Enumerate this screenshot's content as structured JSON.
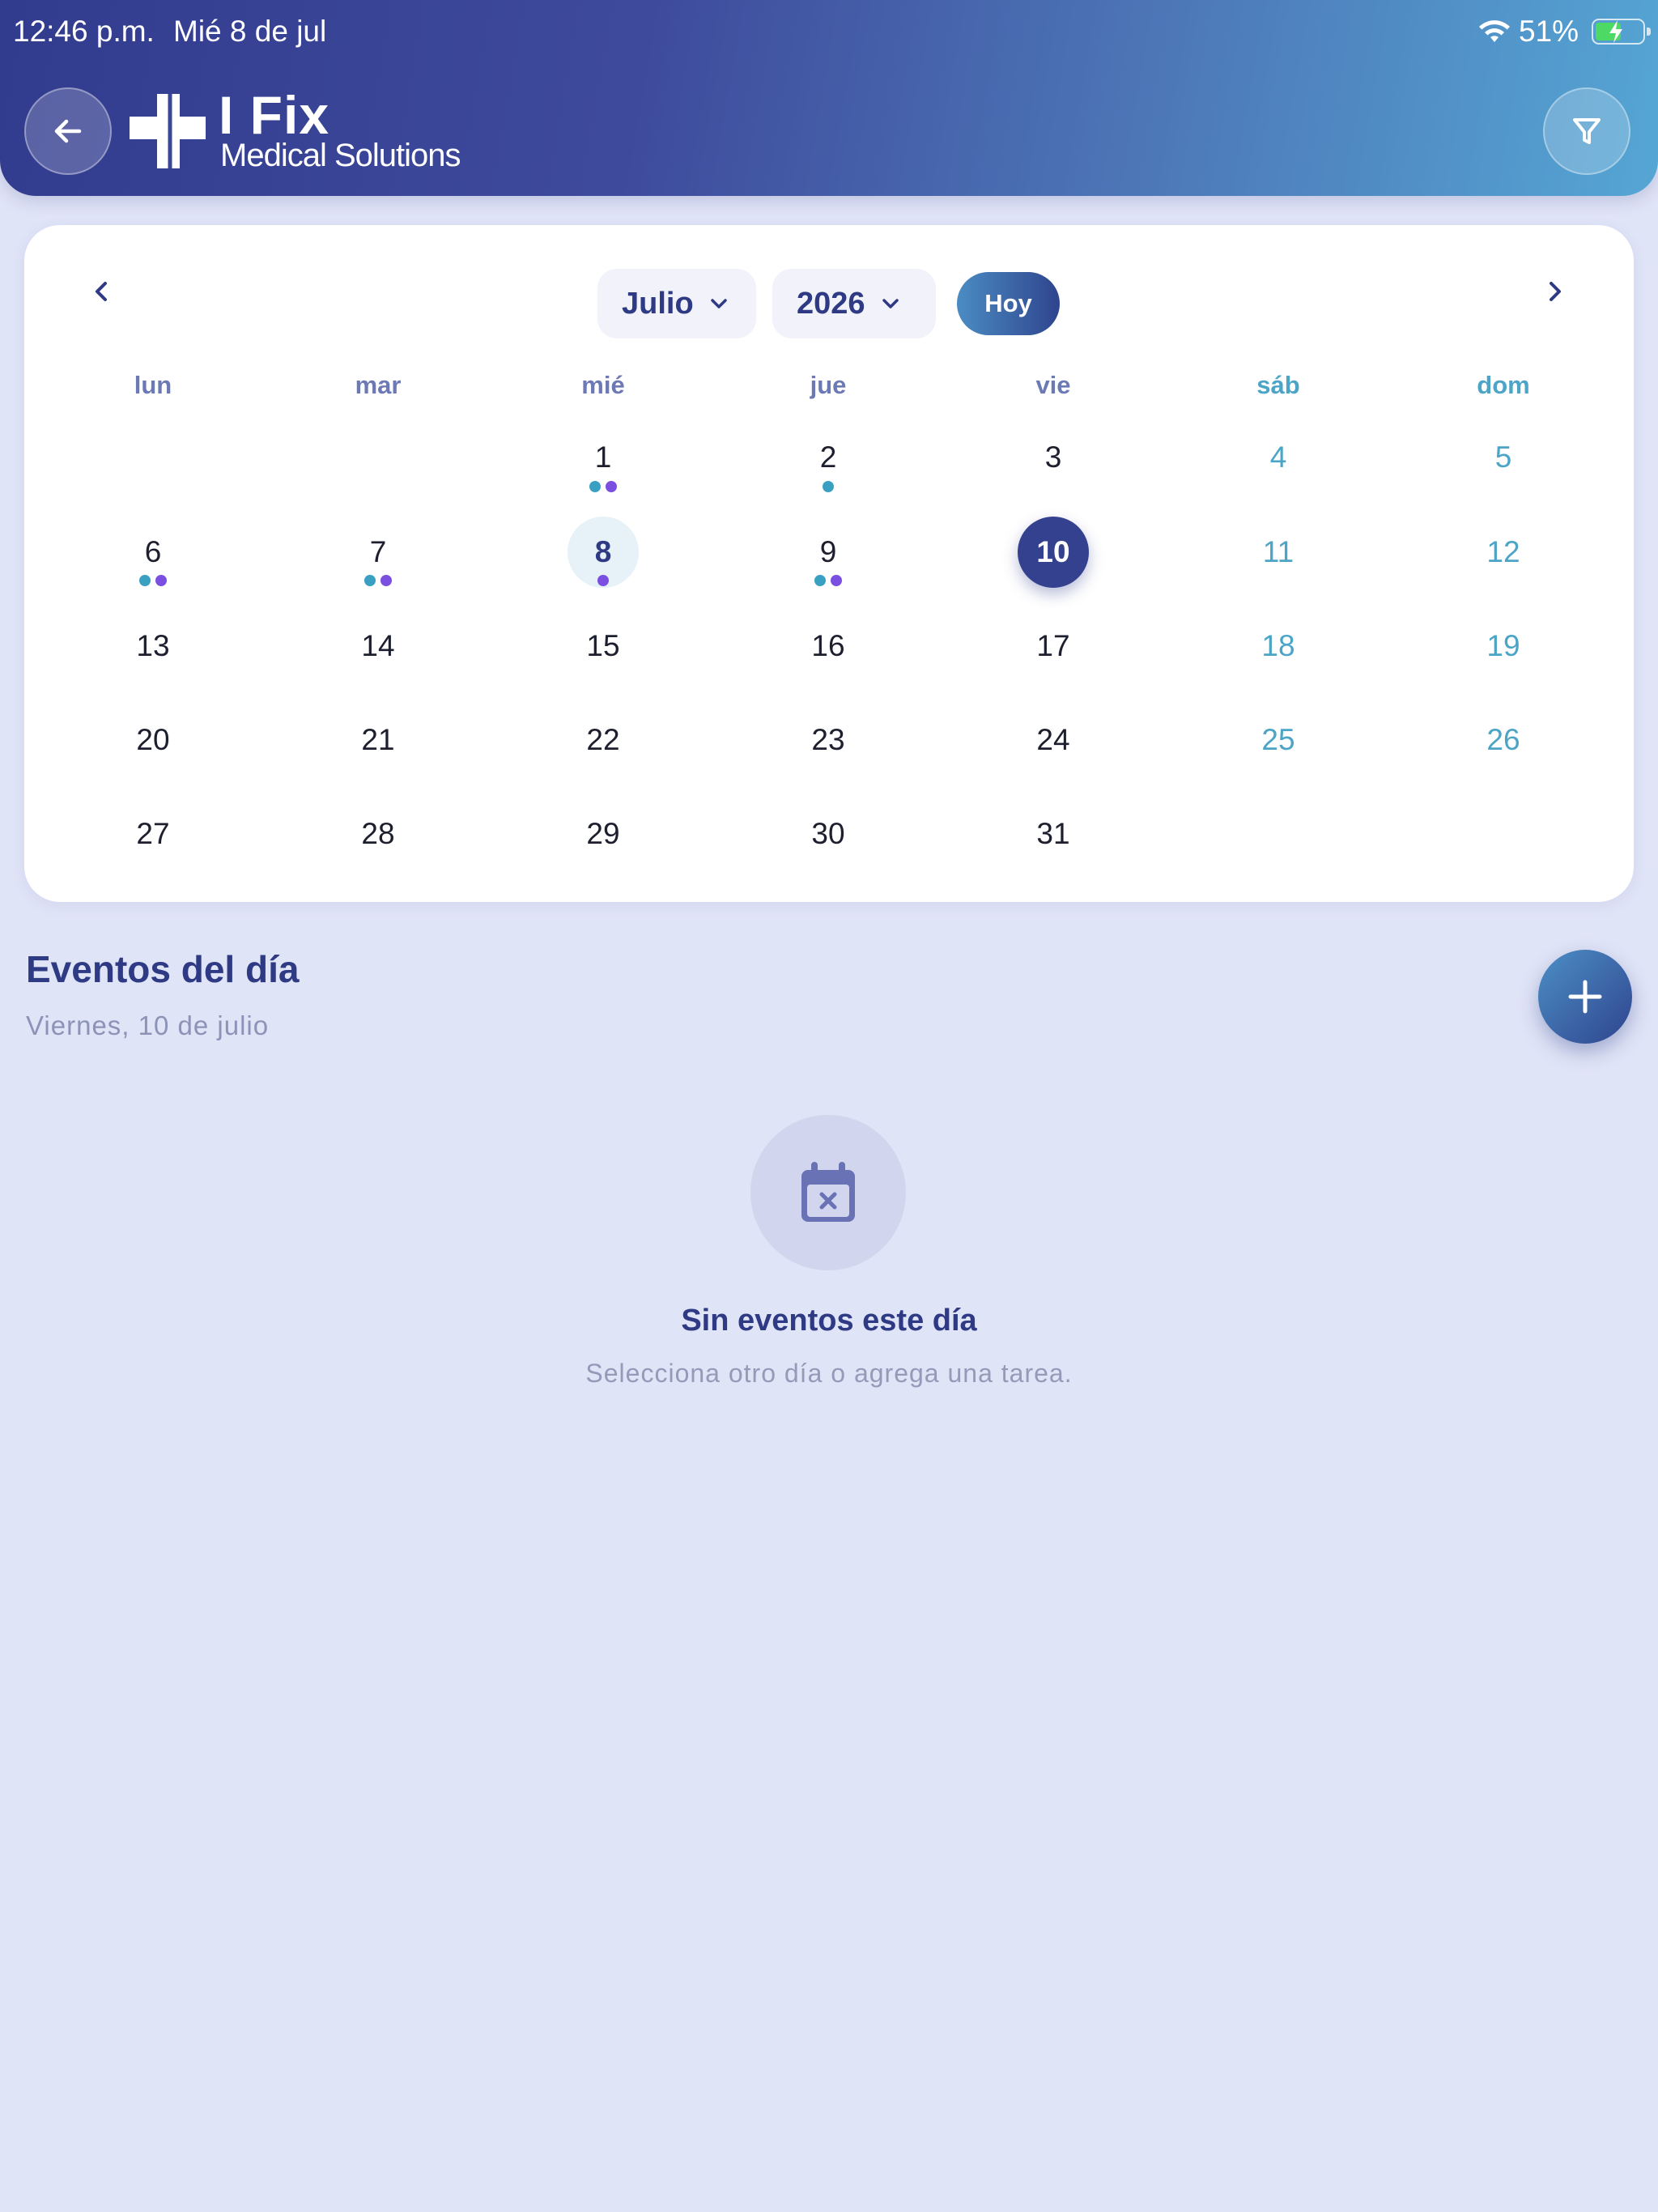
{
  "status_bar": {
    "time": "12:46 p.m.",
    "date": "Mié 8 de jul",
    "battery": "51%"
  },
  "header": {
    "brand": "I Fix",
    "subtitle": "Medical Solutions"
  },
  "calendar": {
    "month": "Julio",
    "year": "2026",
    "today_button": "Hoy",
    "weekdays": [
      "lun",
      "mar",
      "mié",
      "jue",
      "vie",
      "sáb",
      "dom"
    ],
    "days": [
      "1",
      "2",
      "3",
      "4",
      "5",
      "6",
      "7",
      "8",
      "9",
      "10",
      "11",
      "12",
      "13",
      "14",
      "15",
      "16",
      "17",
      "18",
      "19",
      "20",
      "21",
      "22",
      "23",
      "24",
      "25",
      "26",
      "27",
      "28",
      "29",
      "30",
      "31"
    ],
    "today": "8",
    "selected": "10",
    "event_colors": {
      "teal": "#3aa0c2",
      "purple": "#7b4fe0"
    }
  },
  "events": {
    "title": "Eventos del día",
    "date": "Viernes, 10 de julio",
    "empty_title": "Sin eventos este día",
    "empty_subtitle": "Selecciona otro día o agrega una tarea."
  },
  "colors": {
    "primary": "#2e3a84",
    "accent": "#4ca5c6",
    "background": "#e0e4f7"
  }
}
